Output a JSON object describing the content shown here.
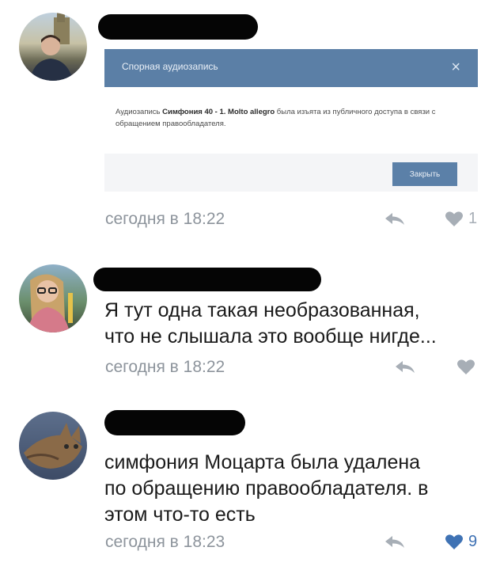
{
  "comments": [
    {
      "time": "сегодня в 18:22",
      "likes": "1",
      "modal": {
        "title": "Спорная аудиозапись",
        "close_glyph": "×",
        "msg_prefix": "Аудиозапись ",
        "track": "Симфония 40 - 1. Molto allegro",
        "msg_suffix": " была изъята из публичного доступа в связи с обращением правообладателя.",
        "button_label": "Закрыть"
      }
    },
    {
      "text": "Я тут одна такая необразованная,\nчто не слышала это вообще нигде...",
      "time": "сегодня в 18:22",
      "likes": ""
    },
    {
      "text": "симфония Моцарта была удалена\nпо обращению правообладателя. в\nэтом что-то есть",
      "time": "сегодня в 18:23",
      "likes": "9"
    }
  ],
  "colors": {
    "accent": "#5b7fa6",
    "meta": "#8d949c",
    "like_active": "#3f72b4",
    "like_inactive": "#a7aeb6"
  },
  "icons": [
    "reply-icon",
    "heart-icon",
    "close-icon"
  ]
}
